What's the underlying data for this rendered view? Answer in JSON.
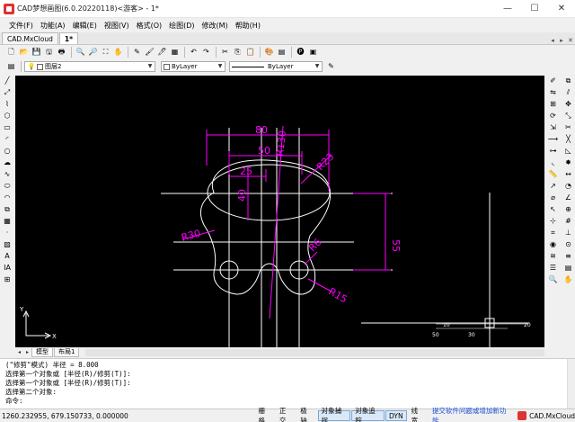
{
  "window": {
    "title": "CAD梦想画图(6.0.20220118)<游客> - 1*",
    "minimize": "—",
    "maximize": "☐",
    "close": "✕"
  },
  "menu": [
    "文件(F)",
    "功能(A)",
    "编辑(E)",
    "视图(V)",
    "格式(O)",
    "绘图(D)",
    "修改(M)",
    "帮助(H)"
  ],
  "doc_tabs": {
    "items": [
      "CAD.MxCloud",
      "1*"
    ],
    "active": 1,
    "controls": [
      "◂",
      "▸",
      "✕"
    ]
  },
  "toolbar1": {
    "icons": [
      "new-file-icon",
      "open-folder-icon",
      "save-icon",
      "save-as-icon",
      "print-icon",
      "zoom-in-icon",
      "zoom-window-icon",
      "zoom-extents-icon",
      "pan-icon",
      "pencil-icon",
      "brush-icon",
      "match-properties-icon",
      "block-icon",
      "undo-icon",
      "redo-icon",
      "cut-icon",
      "copy-icon",
      "paste-icon",
      "palette-icon",
      "layer-manager-icon",
      "pdf-icon",
      "image-icon"
    ],
    "glyphs": [
      "🗋",
      "📂",
      "💾",
      "🖫",
      "🖶",
      "🔍",
      "🔎",
      "⛶",
      "✋",
      "✎",
      "🖌",
      "🖊",
      "▦",
      "↶",
      "↷",
      "✂",
      "⎘",
      "📋",
      "🎨",
      "▤",
      "🅟",
      "▣"
    ]
  },
  "toolbar2": {
    "layer": "图层2",
    "color": "ByLayer",
    "linetype": "ByLayer",
    "colors": {
      "layer_swatch": "#ffffff"
    }
  },
  "left_tools": {
    "icons": [
      "line-icon",
      "ray-icon",
      "polyline-icon",
      "polygon-icon",
      "rectangle-icon",
      "arc-icon",
      "circle-icon",
      "cloud-icon",
      "spline-icon",
      "ellipse-icon",
      "ellipse-arc-icon",
      "insert-block-icon",
      "make-block-icon",
      "point-icon",
      "hatch-icon",
      "text-icon",
      "mtext-icon",
      "table-icon"
    ],
    "glyphs": [
      "╱",
      "⤢",
      "⌇",
      "⬡",
      "▭",
      "◜",
      "○",
      "☁",
      "∿",
      "⬭",
      "◠",
      "⧉",
      "▦",
      "·",
      "▨",
      "A",
      "IA",
      "⊞"
    ]
  },
  "right_tools": {
    "icons": [
      "erase-icon",
      "copy-object-icon",
      "mirror-icon",
      "offset-icon",
      "array-icon",
      "move-icon",
      "rotate-icon",
      "scale-icon",
      "stretch-icon",
      "trim-icon",
      "extend-icon",
      "break-icon",
      "join-icon",
      "chamfer-icon",
      "fillet-icon",
      "explode-icon",
      "measure-icon",
      "dimension-linear-icon",
      "dimension-aligned-icon",
      "dimension-radius-icon",
      "dimension-diameter-icon",
      "dimension-angle-icon",
      "leader-icon",
      "tolerance-icon",
      "center-mark-icon",
      "grid-icon",
      "snap-icon",
      "ortho-icon",
      "polar-icon",
      "osnap-icon",
      "otrack-icon",
      "lineweight-icon",
      "properties-icon",
      "layer-icon",
      "zoom-icon",
      "pan-view-icon"
    ],
    "glyphs": [
      "✐",
      "⧉",
      "⇋",
      "⫽",
      "⊞",
      "✥",
      "⟳",
      "⤡",
      "⇲",
      "✂",
      "⟶",
      "╳",
      "⊶",
      "◺",
      "◟",
      "✸",
      "📏",
      "↔",
      "↗",
      "◔",
      "⌀",
      "∠",
      "↖",
      "⊕",
      "⊹",
      "#",
      "⌗",
      "⊥",
      "◉",
      "⊙",
      "≋",
      "≡",
      "☰",
      "▤",
      "🔍",
      "✋"
    ]
  },
  "drawing": {
    "dims": {
      "d80": "80",
      "d50": "50",
      "d25": "25",
      "d40": "40",
      "d55": "55"
    },
    "radii": {
      "r130": "R130",
      "r23": "R23",
      "r30": "R30",
      "r6": "R6",
      "r15": "R15"
    },
    "viewcube": {
      "n10": "10",
      "n30": "30",
      "n20": "20",
      "n50": "50"
    },
    "ucs": {
      "y": "Y",
      "x": "X"
    },
    "colors": {
      "dimension": "#ff00ff",
      "geometry": "#ffffff",
      "background": "#000000"
    }
  },
  "layout_tabs": {
    "nav": [
      "◂",
      "▸"
    ],
    "items": [
      "模型",
      "布局1"
    ],
    "active": 0
  },
  "command": {
    "history": [
      "(\"修剪\"模式) 半径 = 8.000",
      "选择第一个对象或 [半径(R)/修剪(T)]:",
      "选择第一个对象或 [半径(R)/修剪(T)]:",
      "选择第二个对象:"
    ],
    "prompt_label": "命令:",
    "input_value": ""
  },
  "status": {
    "coords": "1260.232955,  679.150733,  0.000000",
    "toggles": [
      {
        "label": "栅格",
        "on": false
      },
      {
        "label": "正交",
        "on": false
      },
      {
        "label": "极轴",
        "on": false
      },
      {
        "label": "对象捕捉",
        "on": true
      },
      {
        "label": "对象追踪",
        "on": true
      },
      {
        "label": "DYN",
        "on": true
      },
      {
        "label": "线宽",
        "on": false
      }
    ],
    "feedback_link": "提交软件问题或增加新功能",
    "brand": "CAD.MxCloud"
  }
}
